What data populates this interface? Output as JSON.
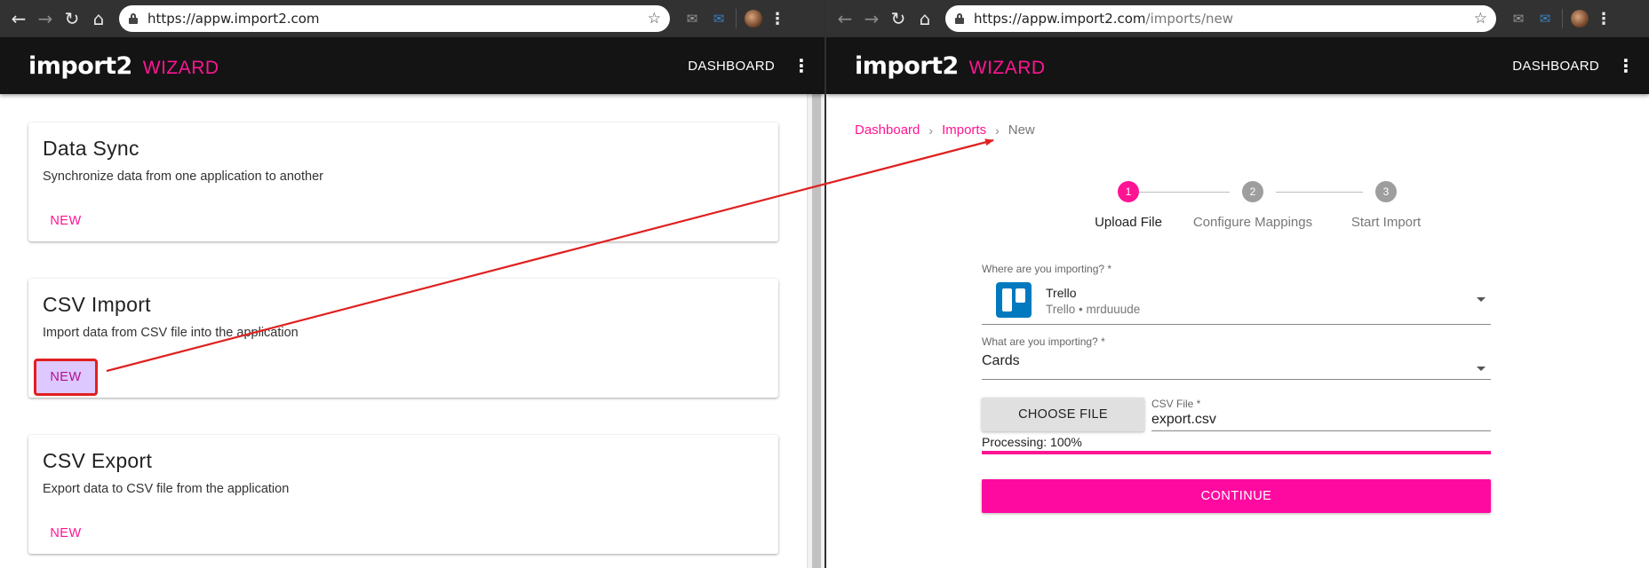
{
  "left_window": {
    "browser": {
      "url_host": "https://appw.import2.com",
      "url_path": "",
      "icons": [
        "back-icon",
        "forward-icon",
        "reload-icon",
        "home-icon",
        "lock-icon",
        "star-icon",
        "mail-icon",
        "mail-blue-icon",
        "avatar",
        "more-vert-icon"
      ]
    },
    "app_bar": {
      "logo": "import2",
      "logo_sub": "WIZARD",
      "nav_dashboard": "DASHBOARD"
    },
    "cards": [
      {
        "title": "Data Sync",
        "description": "Synchronize data from one application to another",
        "button": "NEW",
        "highlighted": false
      },
      {
        "title": "CSV Import",
        "description": "Import data from CSV file into the application",
        "button": "NEW",
        "highlighted": true
      },
      {
        "title": "CSV Export",
        "description": "Export data to CSV file from the application",
        "button": "NEW",
        "highlighted": false
      }
    ]
  },
  "right_window": {
    "browser": {
      "url_host": "https://appw.import2.com",
      "url_path": "/imports/new"
    },
    "app_bar": {
      "logo": "import2",
      "logo_sub": "WIZARD",
      "nav_dashboard": "DASHBOARD"
    },
    "breadcrumb": [
      "Dashboard",
      "Imports",
      "New"
    ],
    "stepper": [
      {
        "number": "1",
        "label": "Upload File",
        "active": true
      },
      {
        "number": "2",
        "label": "Configure Mappings",
        "active": false
      },
      {
        "number": "3",
        "label": "Start Import",
        "active": false
      }
    ],
    "form": {
      "source_label": "Where are you importing? *",
      "source_name": "Trello",
      "source_account": "Trello • mrduuude",
      "type_label": "What are you importing? *",
      "type_value": "Cards",
      "choose_file": "CHOOSE FILE",
      "file_label": "CSV File *",
      "file_name": "export.csv",
      "processing_text": "Processing: 100%",
      "progress": 1.0,
      "continue": "CONTINUE"
    }
  },
  "colors": {
    "accent": "#ff1493",
    "app_bar": "#141414",
    "chrome": "#323232",
    "annotation": "#e02020"
  }
}
